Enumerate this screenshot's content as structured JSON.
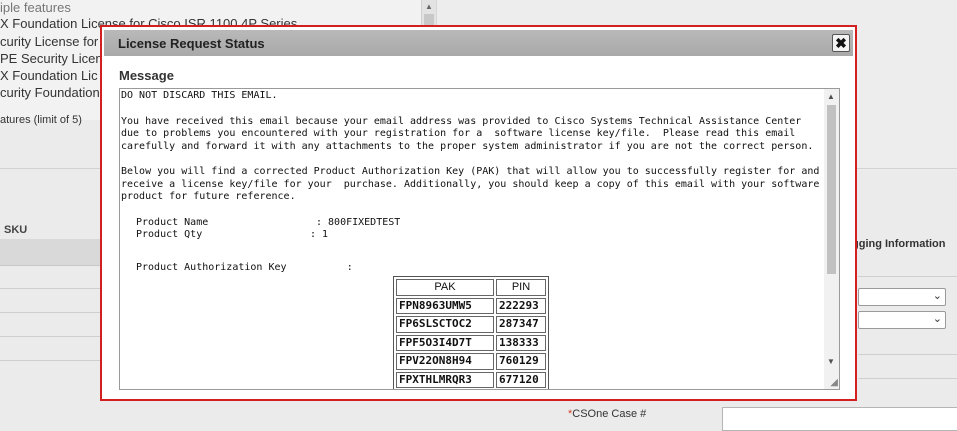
{
  "background": {
    "list_items": [
      "iple features",
      "X Foundation License for Cisco ISR 1100 4P Series",
      "curity License for C",
      "PE Security Licen",
      "X Foundation Lic",
      "curity Foundation L"
    ],
    "limit_text": "atures (limit of 5)",
    "sku_label": "SKU",
    "logging_label": "gging Information",
    "case_label_required": "*",
    "case_label": "CSOne Case #"
  },
  "modal": {
    "title": "License Request Status",
    "close_symbol": "✖",
    "message_label": "Message",
    "paragraphs": [
      "DO NOT DISCARD THIS EMAIL.",
      "You have received this email because your email address was provided to Cisco Systems Technical Assistance Center due to problems you encountered with your registration for a  software license key/file.  Please read this email carefully and forward it with any attachments to the proper system administrator if you are not the correct person.",
      "Below you will find a corrected Product Authorization Key (PAK) that will allow you to successfully register for and receive a license key/file for your  purchase. Additionally, you should keep a copy of this email with your software product for future reference."
    ],
    "product_name_label": "Product Name",
    "product_name_value": ":   800FIXEDTEST",
    "product_qty_label": "Product Qty",
    "product_qty_value": ":  1",
    "pak_label": "Product Authorization Key          :",
    "table": {
      "headers": [
        "PAK",
        "PIN"
      ],
      "rows": [
        [
          "FPN8963UMW5",
          "222293"
        ],
        [
          "FP6SLSCTOC2",
          "287347"
        ],
        [
          "FPF5O3I4D7T",
          "138333"
        ],
        [
          "FPV22ON8H94",
          "760129"
        ],
        [
          "FPXTHLMRQR3",
          "677120"
        ]
      ]
    }
  }
}
